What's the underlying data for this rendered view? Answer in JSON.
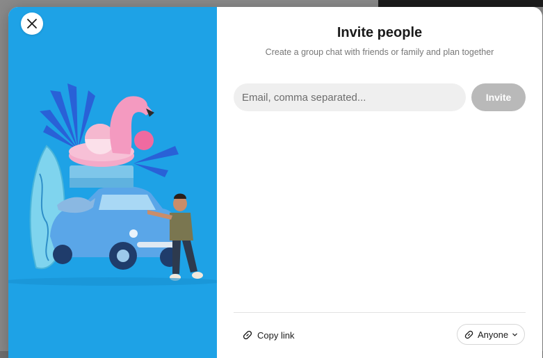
{
  "dialog": {
    "title": "Invite people",
    "subtitle": "Create a group chat with friends or family and plan together"
  },
  "invite": {
    "email_placeholder": "Email, comma separated...",
    "email_value": "",
    "button_label": "Invite"
  },
  "footer": {
    "copy_link_label": "Copy link",
    "access_label": "Anyone"
  },
  "icons": {
    "close": "close-icon",
    "link": "link-icon",
    "chevron": "chevron-down-icon"
  },
  "colors": {
    "hero_background": "#1ea2e6",
    "invite_button_disabled": "#b9b9b9",
    "input_background": "#efefef"
  }
}
